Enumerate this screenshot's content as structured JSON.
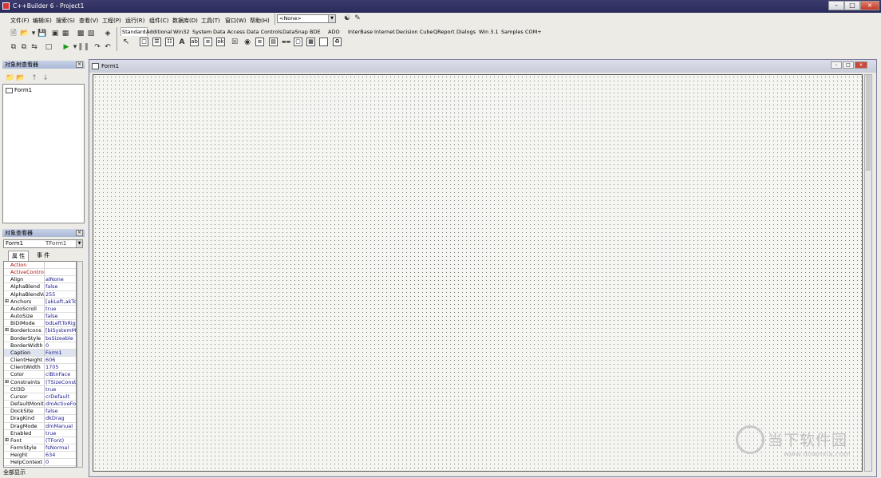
{
  "window": {
    "title": "C++Builder 6 - Project1"
  },
  "menu": [
    "文件(F)",
    "编辑(E)",
    "搜索(S)",
    "查看(V)",
    "工程(P)",
    "运行(R)",
    "组件(C)",
    "数据库(D)",
    "工具(T)",
    "窗口(W)",
    "帮助(H)"
  ],
  "toolbar": {
    "combo_value": "<None>"
  },
  "palette_tabs": [
    "Standard",
    "Additional",
    "Win32",
    "System",
    "Data Access",
    "Data Controls",
    "DataSnap",
    "BDE",
    "ADO",
    "InterBase",
    "Internet",
    "Decision Cube",
    "QReport",
    "Dialogs",
    "Win 3.1",
    "Samples",
    "COM+"
  ],
  "tree_view": {
    "title": "对象树查看器",
    "items": [
      "Form1"
    ]
  },
  "inspector": {
    "title": "对象查看器",
    "object": "Form1",
    "object_class": "TForm1",
    "tabs": [
      "属 性",
      "事 件"
    ],
    "properties": [
      {
        "name": "Action",
        "value": "",
        "red": true
      },
      {
        "name": "ActiveControl",
        "value": "",
        "red": true
      },
      {
        "name": "Align",
        "value": "alNone"
      },
      {
        "name": "AlphaBlend",
        "value": "false"
      },
      {
        "name": "AlphaBlendVal",
        "value": "255"
      },
      {
        "name": "Anchors",
        "value": "[akLeft,akTop]",
        "expand": true
      },
      {
        "name": "AutoScroll",
        "value": "true"
      },
      {
        "name": "AutoSize",
        "value": "false"
      },
      {
        "name": "BiDiMode",
        "value": "bdLeftToRigh"
      },
      {
        "name": "BorderIcons",
        "value": "[biSystemMen",
        "expand": true
      },
      {
        "name": "BorderStyle",
        "value": "bsSizeable"
      },
      {
        "name": "BorderWidth",
        "value": "0"
      },
      {
        "name": "Caption",
        "value": "Form1",
        "selected": true
      },
      {
        "name": "ClientHeight",
        "value": "606"
      },
      {
        "name": "ClientWidth",
        "value": "1705"
      },
      {
        "name": "Color",
        "value": "clBtnFace"
      },
      {
        "name": "Constraints",
        "value": "(TSizeConstra",
        "expand": true
      },
      {
        "name": "Ctl3D",
        "value": "true"
      },
      {
        "name": "Cursor",
        "value": "crDefault"
      },
      {
        "name": "DefaultMonitor",
        "value": "dmActiveForm"
      },
      {
        "name": "DockSite",
        "value": "false"
      },
      {
        "name": "DragKind",
        "value": "dkDrag"
      },
      {
        "name": "DragMode",
        "value": "dmManual"
      },
      {
        "name": "Enabled",
        "value": "true"
      },
      {
        "name": "Font",
        "value": "(TFont)",
        "expand": true
      },
      {
        "name": "FormStyle",
        "value": "fsNormal"
      },
      {
        "name": "Height",
        "value": "634"
      },
      {
        "name": "HelpContext",
        "value": "0"
      }
    ],
    "status": "全部显示"
  },
  "form": {
    "title": "Form1"
  },
  "watermark": {
    "text": "当下软件园",
    "url": "www.downxia.com"
  }
}
